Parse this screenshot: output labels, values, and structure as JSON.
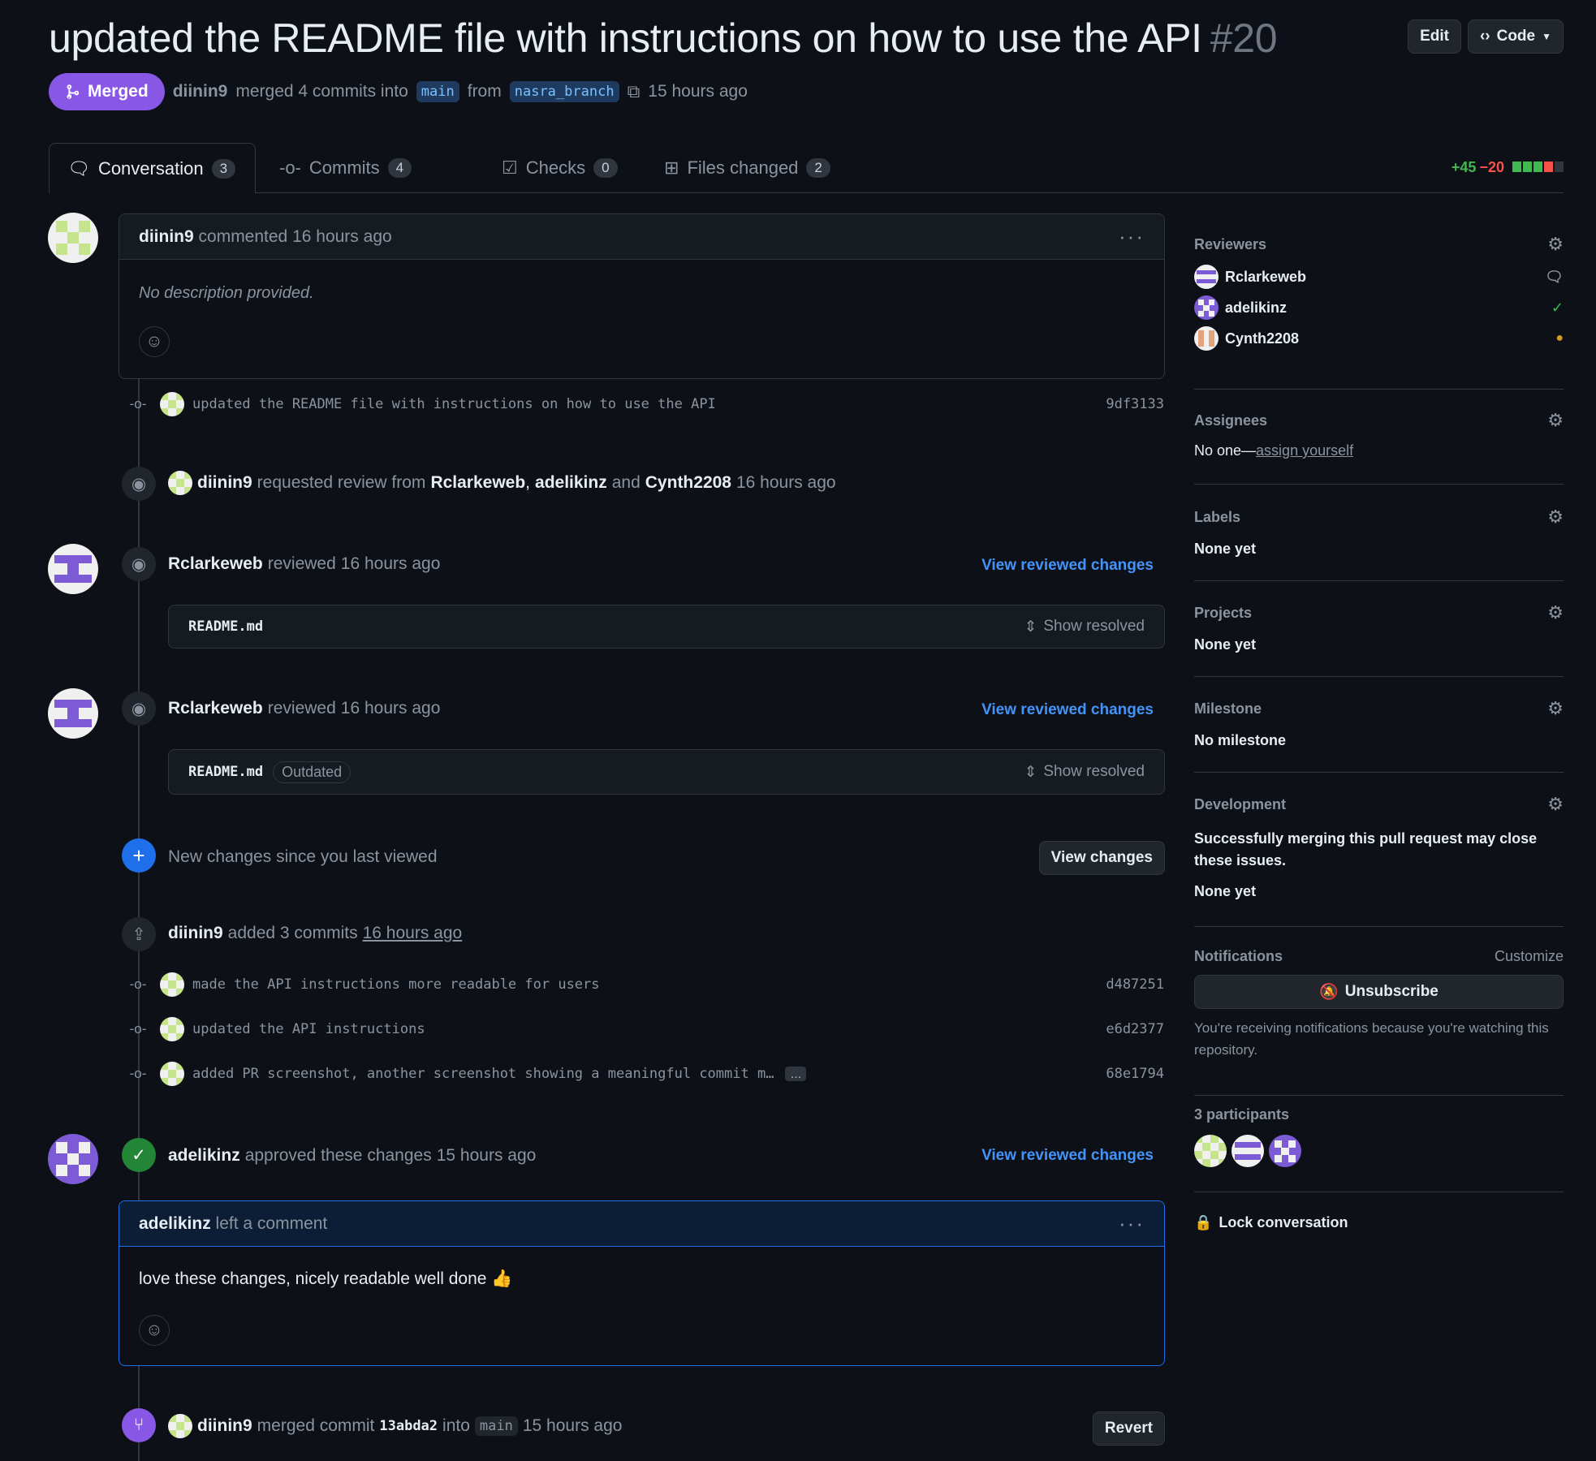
{
  "header": {
    "title": "updated the README file with instructions on how to use the API",
    "number": "#20",
    "edit_label": "Edit",
    "code_label": "Code",
    "state_label": "Merged",
    "author": "diinin9",
    "merged_text": "merged 4 commits into",
    "base_branch": "main",
    "from_text": "from",
    "head_branch": "nasra_branch",
    "time": "15 hours ago"
  },
  "tabs": [
    {
      "label": "Conversation",
      "count": "3"
    },
    {
      "label": "Commits",
      "count": "4"
    },
    {
      "label": "Checks",
      "count": "0"
    },
    {
      "label": "Files changed",
      "count": "2"
    }
  ],
  "diffstat": {
    "added": "+45",
    "removed": "−20"
  },
  "timeline": {
    "comment1": {
      "author": "diinin9",
      "action": "commented",
      "time": "16 hours ago",
      "body": "No description provided."
    },
    "commit1": {
      "message": "updated the README file with instructions on how to use the API",
      "sha": "9df3133"
    },
    "review_request": {
      "author": "diinin9",
      "text": "requested review from",
      "r1": "Rclarkeweb",
      "sep": ",",
      "r2": "adelikinz",
      "and": "and",
      "r3": "Cynth2208",
      "time": "16 hours ago"
    },
    "review1": {
      "author": "Rclarkeweb",
      "action": "reviewed",
      "time": "16 hours ago",
      "link": "View reviewed changes",
      "file": "README.md",
      "show_resolved": "Show resolved"
    },
    "review2": {
      "author": "Rclarkeweb",
      "action": "reviewed",
      "time": "16 hours ago",
      "link": "View reviewed changes",
      "file": "README.md",
      "outdated": "Outdated",
      "show_resolved": "Show resolved"
    },
    "new_changes": {
      "text": "New changes since you last viewed",
      "button": "View changes"
    },
    "added_commits": {
      "author": "diinin9",
      "text": "added 3 commits",
      "time": "16 hours ago"
    },
    "commits": [
      {
        "message": "made the API instructions more readable for users",
        "sha": "d487251"
      },
      {
        "message": "updated the API instructions",
        "sha": "e6d2377"
      },
      {
        "message": "added PR screenshot, another screenshot showing a meaningful commit m…",
        "sha": "68e1794",
        "ellipsis": "…"
      }
    ],
    "approval": {
      "author": "adelikinz",
      "text": "approved these changes",
      "time": "15 hours ago",
      "link": "View reviewed changes"
    },
    "comment2": {
      "author": "adelikinz",
      "action": "left a comment",
      "body": "love these changes, nicely readable well done 👍"
    },
    "merge": {
      "author": "diinin9",
      "text": "merged commit",
      "sha": "13abda2",
      "into": "into",
      "branch": "main",
      "time": "15 hours ago",
      "button": "Revert"
    }
  },
  "sidebar": {
    "reviewers_title": "Reviewers",
    "reviewers": [
      {
        "name": "Rclarkeweb",
        "status": "commented"
      },
      {
        "name": "adelikinz",
        "status": "approved"
      },
      {
        "name": "Cynth2208",
        "status": "pending"
      }
    ],
    "assignees_title": "Assignees",
    "assignees_none": "No one—",
    "assign_yourself": "assign yourself",
    "labels_title": "Labels",
    "labels_value": "None yet",
    "projects_title": "Projects",
    "projects_value": "None yet",
    "milestone_title": "Milestone",
    "milestone_value": "No milestone",
    "development_title": "Development",
    "development_text": "Successfully merging this pull request may close these issues.",
    "development_value": "None yet",
    "notifications_title": "Notifications",
    "customize": "Customize",
    "unsubscribe": "Unsubscribe",
    "notifications_text": "You're receiving notifications because you're watching this repository.",
    "participants_title": "3 participants",
    "lock": "Lock conversation"
  },
  "colors": {
    "merged": "#8957e5",
    "link": "#4493f8",
    "add": "#3fb950",
    "del": "#f85149",
    "bg": "#0d1117"
  }
}
